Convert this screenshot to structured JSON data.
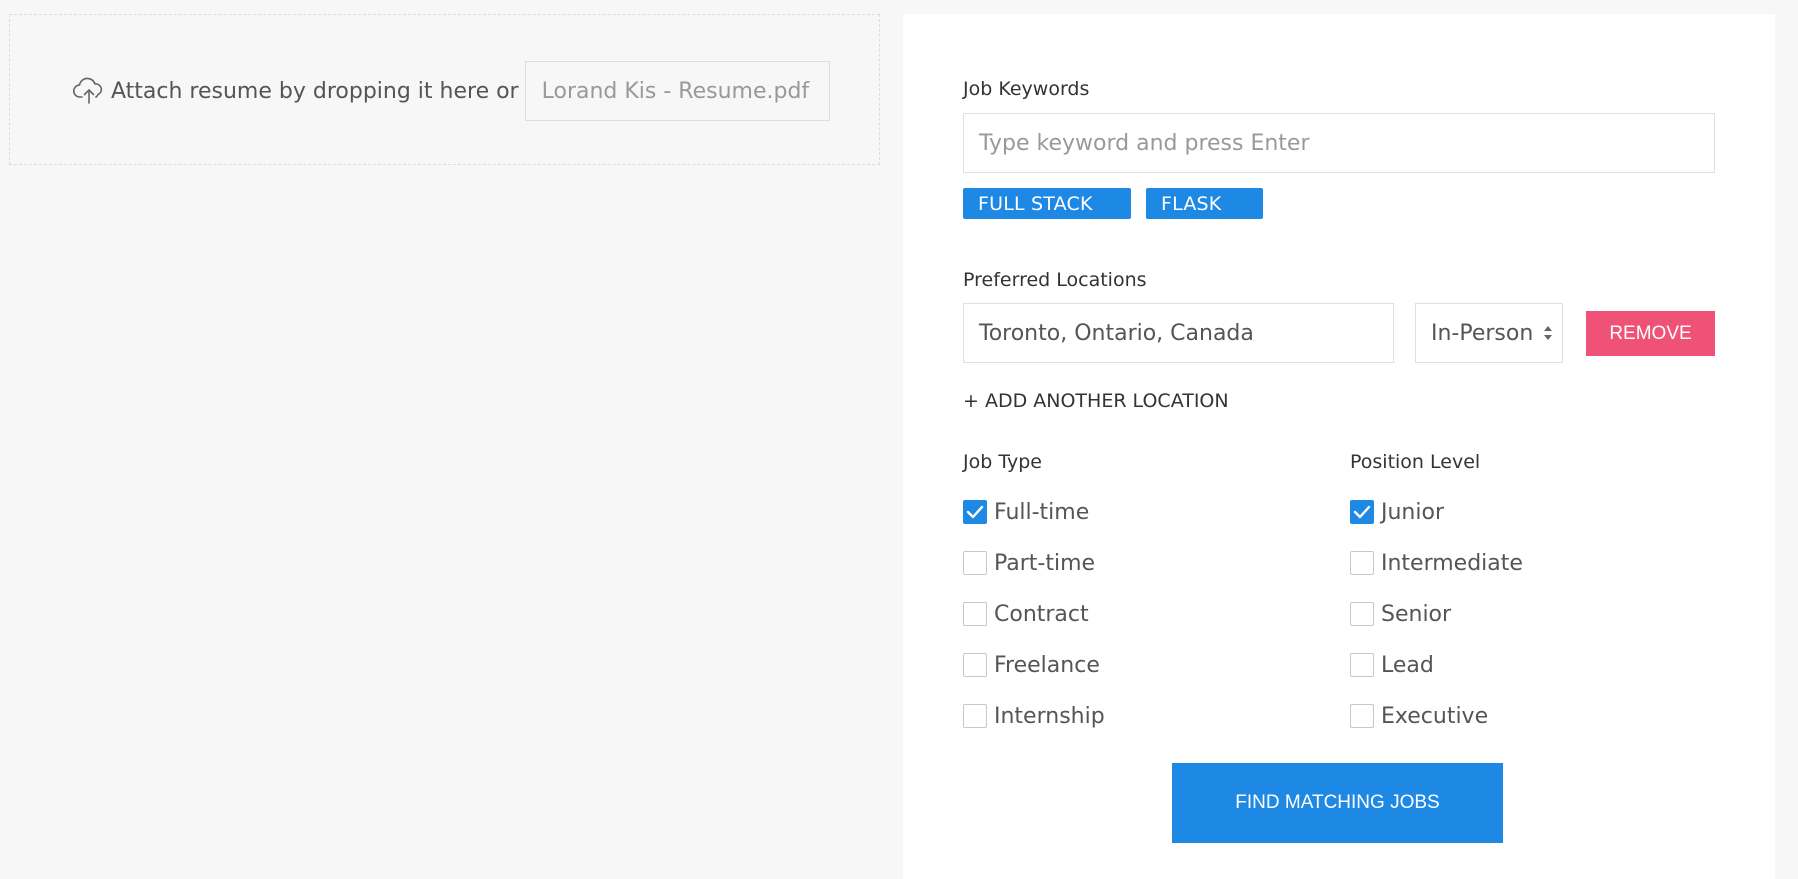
{
  "dropzone": {
    "text": "Attach resume by dropping it here or",
    "file_name": "Lorand Kis - Resume.pdf",
    "icon": "cloud-upload-icon"
  },
  "keywords": {
    "label": "Job Keywords",
    "placeholder": "Type keyword and press Enter",
    "tags": [
      "FULL STACK",
      "FLASK"
    ]
  },
  "locations": {
    "label": "Preferred Locations",
    "items": [
      {
        "location": "Toronto, Ontario, Canada",
        "mode": "In-Person",
        "remove_label": "REMOVE"
      }
    ],
    "add_label": "+ ADD ANOTHER LOCATION"
  },
  "job_type": {
    "label": "Job Type",
    "options": [
      {
        "label": "Full-time",
        "checked": true
      },
      {
        "label": "Part-time",
        "checked": false
      },
      {
        "label": "Contract",
        "checked": false
      },
      {
        "label": "Freelance",
        "checked": false
      },
      {
        "label": "Internship",
        "checked": false
      }
    ]
  },
  "position_level": {
    "label": "Position Level",
    "options": [
      {
        "label": "Junior",
        "checked": true
      },
      {
        "label": "Intermediate",
        "checked": false
      },
      {
        "label": "Senior",
        "checked": false
      },
      {
        "label": "Lead",
        "checked": false
      },
      {
        "label": "Executive",
        "checked": false
      }
    ]
  },
  "submit_label": "FIND MATCHING JOBS",
  "colors": {
    "accent": "#1e88e5",
    "danger": "#ef5276",
    "background": "#f7f7f7",
    "panel": "#ffffff"
  }
}
